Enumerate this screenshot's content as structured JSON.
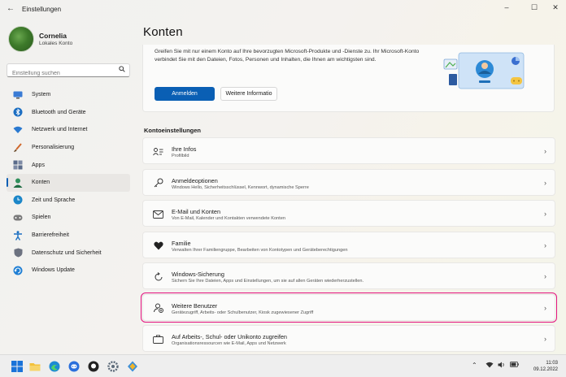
{
  "window": {
    "title": "Einstellungen",
    "controls": {
      "minimize": "–",
      "maximize": "☐",
      "close": "✕"
    }
  },
  "user": {
    "name": "Cornelia",
    "account_type": "Lokales Konto"
  },
  "search": {
    "placeholder": "Einstellung suchen"
  },
  "sidebar": {
    "items": [
      {
        "label": "System",
        "icon": "monitor-icon",
        "color": "#3a7bd5"
      },
      {
        "label": "Bluetooth und Geräte",
        "icon": "bluetooth-icon",
        "color": "#1c6ec2"
      },
      {
        "label": "Netzwerk und Internet",
        "icon": "wifi-icon",
        "color": "#2a79d0"
      },
      {
        "label": "Personalisierung",
        "icon": "brush-icon",
        "color": "#d0672b"
      },
      {
        "label": "Apps",
        "icon": "apps-icon",
        "color": "#5a6b8a"
      },
      {
        "label": "Konten",
        "icon": "person-icon",
        "color": "#2f8f5b",
        "active": true
      },
      {
        "label": "Zeit und Sprache",
        "icon": "globe-clock-icon",
        "color": "#1b86c8"
      },
      {
        "label": "Spielen",
        "icon": "gamepad-icon",
        "color": "#6a6a6a"
      },
      {
        "label": "Barrierefreiheit",
        "icon": "accessibility-icon",
        "color": "#1b6fc2"
      },
      {
        "label": "Datenschutz und Sicherheit",
        "icon": "shield-icon",
        "color": "#6c7280"
      },
      {
        "label": "Windows Update",
        "icon": "update-icon",
        "color": "#1f7fd4"
      }
    ]
  },
  "main": {
    "title": "Konten",
    "banner": {
      "text": "Greifen Sie mit nur einem Konto auf Ihre bevorzugten Microsoft-Produkte und -Dienste zu. Ihr Microsoft-Konto verbindet Sie mit den Dateien, Fotos, Personen und Inhalten, die Ihnen am wichtigsten sind.",
      "primary_label": "Anmelden",
      "secondary_label": "Weitere Informatio"
    },
    "section_title": "Kontoeinstellungen",
    "cards": [
      {
        "title": "Ihre Infos",
        "subtitle": "Profilbild",
        "icon": "id-card-icon"
      },
      {
        "title": "Anmeldeoptionen",
        "subtitle": "Windows Hello, Sicherheitsschlüssel, Kennwort, dynamische Sperre",
        "icon": "key-icon"
      },
      {
        "title": "E-Mail und Konten",
        "subtitle": "Von E-Mail, Kalender und Kontakten verwendete Konten",
        "icon": "mail-icon"
      },
      {
        "title": "Familie",
        "subtitle": "Verwalten Ihrer Familiengruppe, Bearbeiten von Kontotypen und Geräteberechtigungen",
        "icon": "heart-icon"
      },
      {
        "title": "Windows-Sicherung",
        "subtitle": "Sichern Sie Ihre Dateien, Apps und Einstellungen, um sie auf allen Geräten wiederherzustellen.",
        "icon": "backup-icon"
      },
      {
        "title": "Weitere Benutzer",
        "subtitle": "Gerätezugriff, Arbeits- oder Schulbenutzer, Kiosk zugewiesener Zugriff",
        "icon": "add-user-icon",
        "highlighted": true
      },
      {
        "title": "Auf Arbeits-, Schul- oder Unikonto zugreifen",
        "subtitle": "Organisationsressourcen wie E-Mail, Apps und Netzwerk",
        "icon": "briefcase-icon"
      }
    ]
  },
  "taskbar": {
    "apps": [
      "windows-start-icon",
      "file-explorer-icon",
      "edge-icon",
      "discord-icon",
      "github-icon",
      "settings-icon",
      "app-icon"
    ],
    "time": "11:03",
    "date": "09.12.2022"
  },
  "colors": {
    "accent": "#0a5fb4",
    "highlight": "#e3127f"
  }
}
